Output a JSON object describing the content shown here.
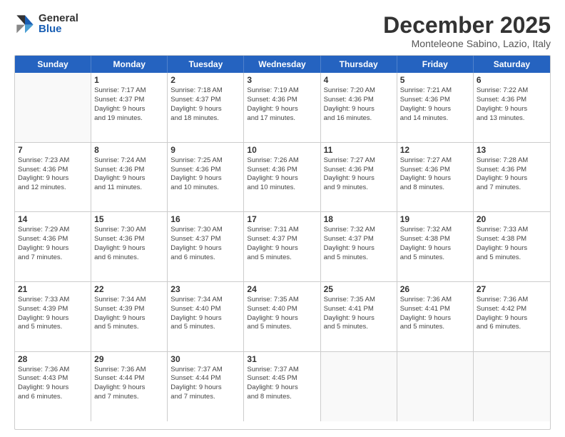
{
  "logo": {
    "general": "General",
    "blue": "Blue"
  },
  "title": "December 2025",
  "subtitle": "Monteleone Sabino, Lazio, Italy",
  "weekdays": [
    "Sunday",
    "Monday",
    "Tuesday",
    "Wednesday",
    "Thursday",
    "Friday",
    "Saturday"
  ],
  "weeks": [
    [
      {
        "date": "",
        "info": ""
      },
      {
        "date": "1",
        "info": "Sunrise: 7:17 AM\nSunset: 4:37 PM\nDaylight: 9 hours\nand 19 minutes."
      },
      {
        "date": "2",
        "info": "Sunrise: 7:18 AM\nSunset: 4:37 PM\nDaylight: 9 hours\nand 18 minutes."
      },
      {
        "date": "3",
        "info": "Sunrise: 7:19 AM\nSunset: 4:36 PM\nDaylight: 9 hours\nand 17 minutes."
      },
      {
        "date": "4",
        "info": "Sunrise: 7:20 AM\nSunset: 4:36 PM\nDaylight: 9 hours\nand 16 minutes."
      },
      {
        "date": "5",
        "info": "Sunrise: 7:21 AM\nSunset: 4:36 PM\nDaylight: 9 hours\nand 14 minutes."
      },
      {
        "date": "6",
        "info": "Sunrise: 7:22 AM\nSunset: 4:36 PM\nDaylight: 9 hours\nand 13 minutes."
      }
    ],
    [
      {
        "date": "7",
        "info": "Sunrise: 7:23 AM\nSunset: 4:36 PM\nDaylight: 9 hours\nand 12 minutes."
      },
      {
        "date": "8",
        "info": "Sunrise: 7:24 AM\nSunset: 4:36 PM\nDaylight: 9 hours\nand 11 minutes."
      },
      {
        "date": "9",
        "info": "Sunrise: 7:25 AM\nSunset: 4:36 PM\nDaylight: 9 hours\nand 10 minutes."
      },
      {
        "date": "10",
        "info": "Sunrise: 7:26 AM\nSunset: 4:36 PM\nDaylight: 9 hours\nand 10 minutes."
      },
      {
        "date": "11",
        "info": "Sunrise: 7:27 AM\nSunset: 4:36 PM\nDaylight: 9 hours\nand 9 minutes."
      },
      {
        "date": "12",
        "info": "Sunrise: 7:27 AM\nSunset: 4:36 PM\nDaylight: 9 hours\nand 8 minutes."
      },
      {
        "date": "13",
        "info": "Sunrise: 7:28 AM\nSunset: 4:36 PM\nDaylight: 9 hours\nand 7 minutes."
      }
    ],
    [
      {
        "date": "14",
        "info": "Sunrise: 7:29 AM\nSunset: 4:36 PM\nDaylight: 9 hours\nand 7 minutes."
      },
      {
        "date": "15",
        "info": "Sunrise: 7:30 AM\nSunset: 4:36 PM\nDaylight: 9 hours\nand 6 minutes."
      },
      {
        "date": "16",
        "info": "Sunrise: 7:30 AM\nSunset: 4:37 PM\nDaylight: 9 hours\nand 6 minutes."
      },
      {
        "date": "17",
        "info": "Sunrise: 7:31 AM\nSunset: 4:37 PM\nDaylight: 9 hours\nand 5 minutes."
      },
      {
        "date": "18",
        "info": "Sunrise: 7:32 AM\nSunset: 4:37 PM\nDaylight: 9 hours\nand 5 minutes."
      },
      {
        "date": "19",
        "info": "Sunrise: 7:32 AM\nSunset: 4:38 PM\nDaylight: 9 hours\nand 5 minutes."
      },
      {
        "date": "20",
        "info": "Sunrise: 7:33 AM\nSunset: 4:38 PM\nDaylight: 9 hours\nand 5 minutes."
      }
    ],
    [
      {
        "date": "21",
        "info": "Sunrise: 7:33 AM\nSunset: 4:39 PM\nDaylight: 9 hours\nand 5 minutes."
      },
      {
        "date": "22",
        "info": "Sunrise: 7:34 AM\nSunset: 4:39 PM\nDaylight: 9 hours\nand 5 minutes."
      },
      {
        "date": "23",
        "info": "Sunrise: 7:34 AM\nSunset: 4:40 PM\nDaylight: 9 hours\nand 5 minutes."
      },
      {
        "date": "24",
        "info": "Sunrise: 7:35 AM\nSunset: 4:40 PM\nDaylight: 9 hours\nand 5 minutes."
      },
      {
        "date": "25",
        "info": "Sunrise: 7:35 AM\nSunset: 4:41 PM\nDaylight: 9 hours\nand 5 minutes."
      },
      {
        "date": "26",
        "info": "Sunrise: 7:36 AM\nSunset: 4:41 PM\nDaylight: 9 hours\nand 5 minutes."
      },
      {
        "date": "27",
        "info": "Sunrise: 7:36 AM\nSunset: 4:42 PM\nDaylight: 9 hours\nand 6 minutes."
      }
    ],
    [
      {
        "date": "28",
        "info": "Sunrise: 7:36 AM\nSunset: 4:43 PM\nDaylight: 9 hours\nand 6 minutes."
      },
      {
        "date": "29",
        "info": "Sunrise: 7:36 AM\nSunset: 4:44 PM\nDaylight: 9 hours\nand 7 minutes."
      },
      {
        "date": "30",
        "info": "Sunrise: 7:37 AM\nSunset: 4:44 PM\nDaylight: 9 hours\nand 7 minutes."
      },
      {
        "date": "31",
        "info": "Sunrise: 7:37 AM\nSunset: 4:45 PM\nDaylight: 9 hours\nand 8 minutes."
      },
      {
        "date": "",
        "info": ""
      },
      {
        "date": "",
        "info": ""
      },
      {
        "date": "",
        "info": ""
      }
    ]
  ]
}
